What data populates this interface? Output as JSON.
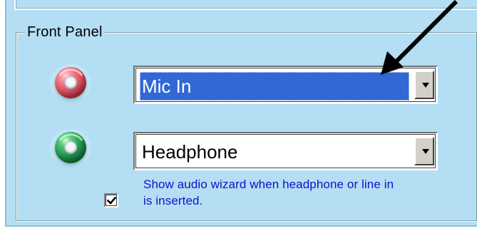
{
  "front_panel": {
    "group_title": "Front Panel",
    "mic_dropdown": {
      "selected_value": "Mic In",
      "jack_color": "#e96d77",
      "selected_background": "#3168d5"
    },
    "headphone_dropdown": {
      "selected_value": "Headphone",
      "jack_color": "#25a85f"
    },
    "audio_wizard": {
      "checked": true,
      "label_line_1": "Show audio wizard when headphone or line in",
      "label_line_2": "is inserted."
    }
  },
  "theme": {
    "panel_background": "#b4def3",
    "wizard_text_color": "#0d12c9",
    "annotation_arrow_color": "#000000"
  },
  "icons": {
    "mic_jack": "pink-audio-jack-icon",
    "headphone_jack": "green-audio-jack-icon",
    "dropdown_arrow": "chevron-down-icon",
    "checkbox_mark": "check-icon",
    "annotation": "arrow-pointer-icon"
  }
}
